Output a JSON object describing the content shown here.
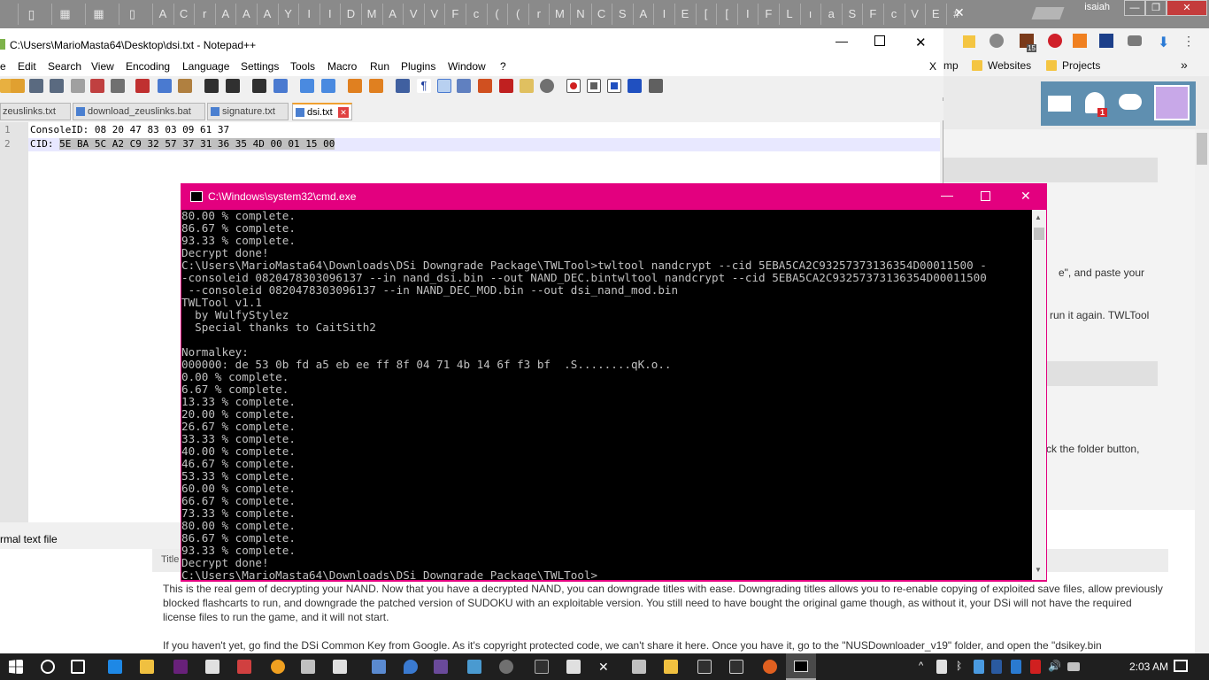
{
  "chrome": {
    "tab_glyphs": [
      "A",
      "C",
      "r",
      "A",
      "A",
      "A",
      "Y",
      "I",
      "I",
      "D",
      "M",
      "A",
      "V",
      "V",
      "F",
      "c",
      "(",
      "(",
      "r",
      "M",
      "N",
      "C",
      "S",
      "A",
      "I",
      "E",
      "[",
      "[",
      "I",
      "F",
      "L",
      "ı",
      "a",
      "S",
      "F",
      "c",
      "V",
      "E",
      "#"
    ],
    "user": "isaiah",
    "bookmarks": [
      "mp",
      "Websites",
      "Projects"
    ],
    "notification_count": "1",
    "ext_badge": "15",
    "more": "»"
  },
  "webpage": {
    "snippets": [
      "e\", and paste your",
      "run it again. TWLTool",
      "ck the folder button,"
    ],
    "title_label": "Title",
    "para1": "This is the real gem of decrypting your NAND. Now that you have a decrypted NAND, you can downgrade titles with ease. Downgrading titles allows you to re-enable copying of exploited save files, allow previously blocked flashcarts to run, and downgrade the patched version of SUDOKU with an exploitable version. You still need to have bought the original game though, as without it, your DSi will not have the required license files to run the game, and it will not start.",
    "para2": "If you haven't yet, go find the DSi Common Key from Google. As it's copyright protected code, we can't share it here. Once you have it, go to the \"NUSDownloader_v19\" folder, and open the \"dsikey.bin"
  },
  "notepad": {
    "title": "C:\\Users\\MarioMasta64\\Desktop\\dsi.txt - Notepad++",
    "menu": [
      "e",
      "Edit",
      "Search",
      "View",
      "Encoding",
      "Language",
      "Settings",
      "Tools",
      "Macro",
      "Run",
      "Plugins",
      "Window",
      "?"
    ],
    "menu_close": "X",
    "tabs": [
      "zeuslinks.txt",
      "download_zeuslinks.bat",
      "signature.txt",
      "dsi.txt"
    ],
    "lines": [
      {
        "num": "1",
        "prefix": "ConsoleID: 08 20 47 83 03 09 61 37",
        "selected": ""
      },
      {
        "num": "2",
        "prefix": "CID: ",
        "selected": "5E BA 5C A2 C9 32 57 37 31 36 35 4D 00 01 15 00"
      }
    ],
    "status": "rmal text file"
  },
  "cmd": {
    "title": "C:\\Windows\\system32\\cmd.exe",
    "lines": [
      "80.00 % complete.",
      "86.67 % complete.",
      "93.33 % complete.",
      "Decrypt done!",
      "C:\\Users\\MarioMasta64\\Downloads\\DSi Downgrade Package\\TWLTool>twltool nandcrypt --cid 5EBA5CA2C93257373136354D00011500 -",
      "-consoleid 0820478303096137 --in nand_dsi.bin --out NAND_DEC.bintwltool nandcrypt --cid 5EBA5CA2C93257373136354D00011500",
      " --consoleid 0820478303096137 --in NAND_DEC_MOD.bin --out dsi_nand_mod.bin",
      "TWLTool v1.1",
      "  by WulfyStylez",
      "  Special thanks to CaitSith2",
      "",
      "Normalkey:",
      "000000: de 53 0b fd a5 eb ee ff 8f 04 71 4b 14 6f f3 bf  .S........qK.o..",
      "0.00 % complete.",
      "6.67 % complete.",
      "13.33 % complete.",
      "20.00 % complete.",
      "26.67 % complete.",
      "33.33 % complete.",
      "40.00 % complete.",
      "46.67 % complete.",
      "53.33 % complete.",
      "60.00 % complete.",
      "66.67 % complete.",
      "73.33 % complete.",
      "80.00 % complete.",
      "86.67 % complete.",
      "93.33 % complete.",
      "Decrypt done!",
      "C:\\Users\\MarioMasta64\\Downloads\\DSi Downgrade Package\\TWLTool>"
    ]
  },
  "taskbar": {
    "time": "2:03 AM"
  },
  "colors": {
    "cmd_border": "#e3007f",
    "taskbar": "#1f1f1f",
    "chrome_strip": "#8a8a8a"
  }
}
